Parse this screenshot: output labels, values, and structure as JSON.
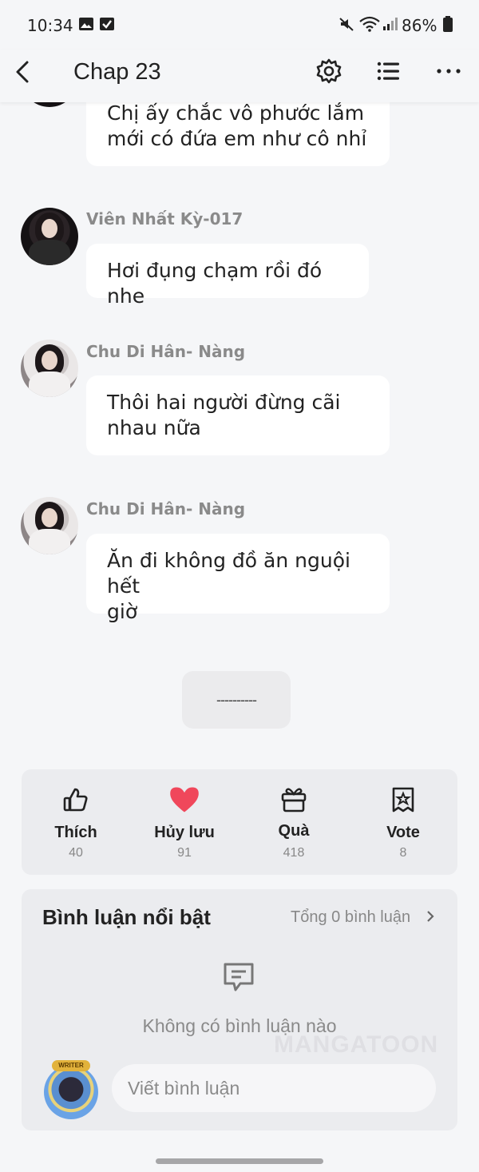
{
  "status_bar": {
    "time": "10:34",
    "battery": "86%"
  },
  "header": {
    "title": "Chap 23"
  },
  "messages": [
    {
      "lines": [
        "Chị ấy chắc vô phước lắm",
        "mới có đứa em như cô nhỉ"
      ]
    },
    {
      "user": "Viên Nhất Kỳ-017",
      "lines": [
        "Hơi đụng chạm rồi đó nhe"
      ]
    },
    {
      "user": "Chu Di Hân- Nàng",
      "lines": [
        "Thôi hai người đừng cãi",
        "nhau nữa"
      ]
    },
    {
      "user": "Chu Di Hân- Nàng",
      "lines": [
        "Ăn đi không đồ ăn nguội hết",
        "giờ"
      ]
    }
  ],
  "divider": "----------",
  "actions": [
    {
      "label": "Thích",
      "count": "40",
      "icon": "thumbs-up-icon"
    },
    {
      "label": "Hủy lưu",
      "count": "91",
      "icon": "heart-icon",
      "color": "#f0475b"
    },
    {
      "label": "Quà",
      "count": "418",
      "icon": "gift-icon"
    },
    {
      "label": "Vote",
      "count": "8",
      "icon": "vote-star-icon"
    }
  ],
  "comments": {
    "title": "Bình luận nổi bật",
    "total": "Tổng 0 bình luận",
    "empty": "Không có bình luận nào",
    "placeholder": "Viết bình luận",
    "badge": "WRITER",
    "watermark": "MANGATOON"
  }
}
